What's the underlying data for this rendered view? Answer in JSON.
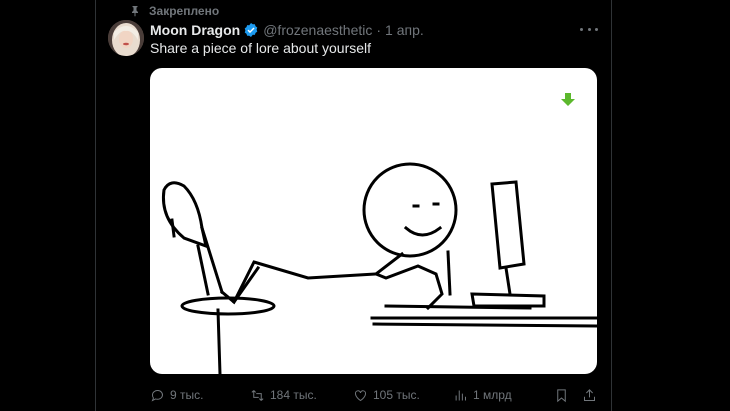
{
  "pinned": {
    "label": "Закреплено",
    "icon": "pin-icon"
  },
  "tweet": {
    "author": {
      "name": "Moon Dragon",
      "handle": "@frozenaesthetic",
      "verified": true
    },
    "date": "1 апр.",
    "separator": "·",
    "text": "Share a piece of lore about yourself",
    "media": {
      "type": "stick figure drawing",
      "download_icon": "download-arrow-icon"
    }
  },
  "actions": {
    "replies": "9 тыс.",
    "retweets": "184 тыс.",
    "likes": "105 тыс.",
    "views": "1 млрд"
  },
  "colors": {
    "background": "#000000",
    "text_primary": "#e7e9ea",
    "text_secondary": "#71767b",
    "verified": "#1d9bf0",
    "border": "#2f3336",
    "download_arrow": "#5cb82d"
  }
}
